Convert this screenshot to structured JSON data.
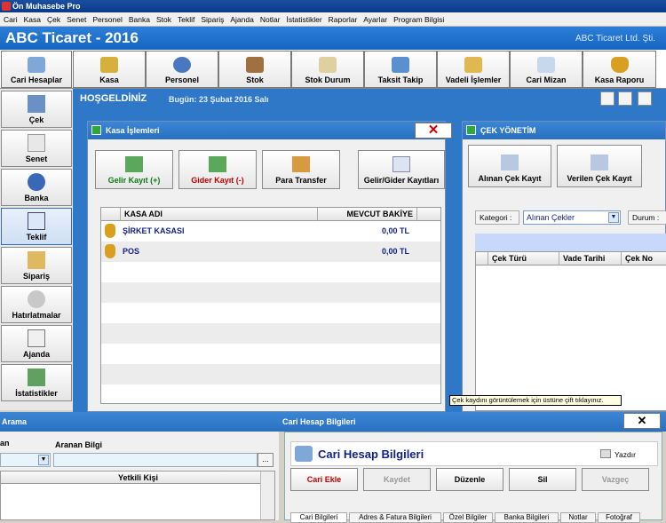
{
  "window": {
    "title": "Ön Muhasebe Pro"
  },
  "menu": [
    "Cari",
    "Kasa",
    "Çek",
    "Senet",
    "Personel",
    "Banka",
    "Stok",
    "Teklif",
    "Sipariş",
    "Ajanda",
    "Notlar",
    "İstatistikler",
    "Raporlar",
    "Ayarlar",
    "Program Bilgisi"
  ],
  "header": {
    "app_title": "ABC Ticaret - 2016",
    "company": "ABC Ticaret Ltd. Şti."
  },
  "toolbar": [
    {
      "label": "Cari Hesaplar",
      "icon": "users-icon"
    },
    {
      "label": "Kasa",
      "icon": "coins-icon"
    },
    {
      "label": "Personel",
      "icon": "person-icon"
    },
    {
      "label": "Stok",
      "icon": "box-icon"
    },
    {
      "label": "Stok Durum",
      "icon": "document-icon"
    },
    {
      "label": "Taksit Takip",
      "icon": "card-icon"
    },
    {
      "label": "Vadeli İşlemler",
      "icon": "folder-icon"
    },
    {
      "label": "Cari Mizan",
      "icon": "chart-icon"
    },
    {
      "label": "Kasa Raporu",
      "icon": "money-bag-icon"
    }
  ],
  "sidebar": [
    {
      "label": "Çek",
      "icon": "cheque-icon"
    },
    {
      "label": "Senet",
      "icon": "note-icon"
    },
    {
      "label": "Banka",
      "icon": "pie-icon"
    },
    {
      "label": "Teklif",
      "icon": "offer-icon"
    },
    {
      "label": "Sipariş",
      "icon": "order-icon"
    },
    {
      "label": "Hatırlatmalar",
      "icon": "clock-icon"
    },
    {
      "label": "Ajanda",
      "icon": "calendar-icon"
    },
    {
      "label": "İstatistikler",
      "icon": "stats-icon"
    }
  ],
  "welcome": {
    "text": "HOŞGELDİNİZ",
    "date": "Bugün: 23 Şubat 2016 Salı"
  },
  "kasa": {
    "title": "Kasa İşlemleri",
    "close": "✕",
    "buttons": [
      "Gelir Kayıt (+)",
      "Gider Kayıt (-)",
      "Para Transfer",
      "Gelir/Gider Kayıtları"
    ],
    "columns": [
      "KASA ADI",
      "MEVCUT BAKİYE"
    ],
    "rows": [
      {
        "name": "ŞİRKET KASASI",
        "balance": "0,00 TL"
      },
      {
        "name": "POS",
        "balance": "0,00 TL"
      }
    ]
  },
  "cek": {
    "title": "ÇEK YÖNETİM",
    "buttons": [
      "Alınan Çek Kayıt",
      "Verilen Çek Kayıt"
    ],
    "category_label": "Kategori :",
    "category_value": "Alınan Çekler",
    "status_label": "Durum :",
    "columns": [
      "Çek Türü",
      "Vade Tarihi",
      "Çek No"
    ],
    "tooltip": "Çek kaydını görüntülemek için üstüne çift tıklayınız."
  },
  "arama": {
    "title": "Arama",
    "left_label": "an",
    "search_label": "Aranan Bilgi",
    "browse": "...",
    "column": "Yetkili Kişi"
  },
  "cari": {
    "title": "Cari Hesap Bilgileri",
    "close": "✕",
    "heading": "Cari Hesap Bilgileri",
    "print": "Yazdır",
    "buttons": [
      "Cari Ekle",
      "Kaydet",
      "Düzenle",
      "Sil",
      "Vazgeç"
    ],
    "tabs": [
      "Cari Bilgileri",
      "Adres & Fatura Bilgileri",
      "Özel Bilgiler",
      "Banka Bilgileri",
      "Notlar",
      "Fotoğraf"
    ]
  },
  "colors": {
    "accent": "#2f78c8",
    "positive": "#0b7a10",
    "negative": "#c00000",
    "link": "#0f1f8a"
  }
}
